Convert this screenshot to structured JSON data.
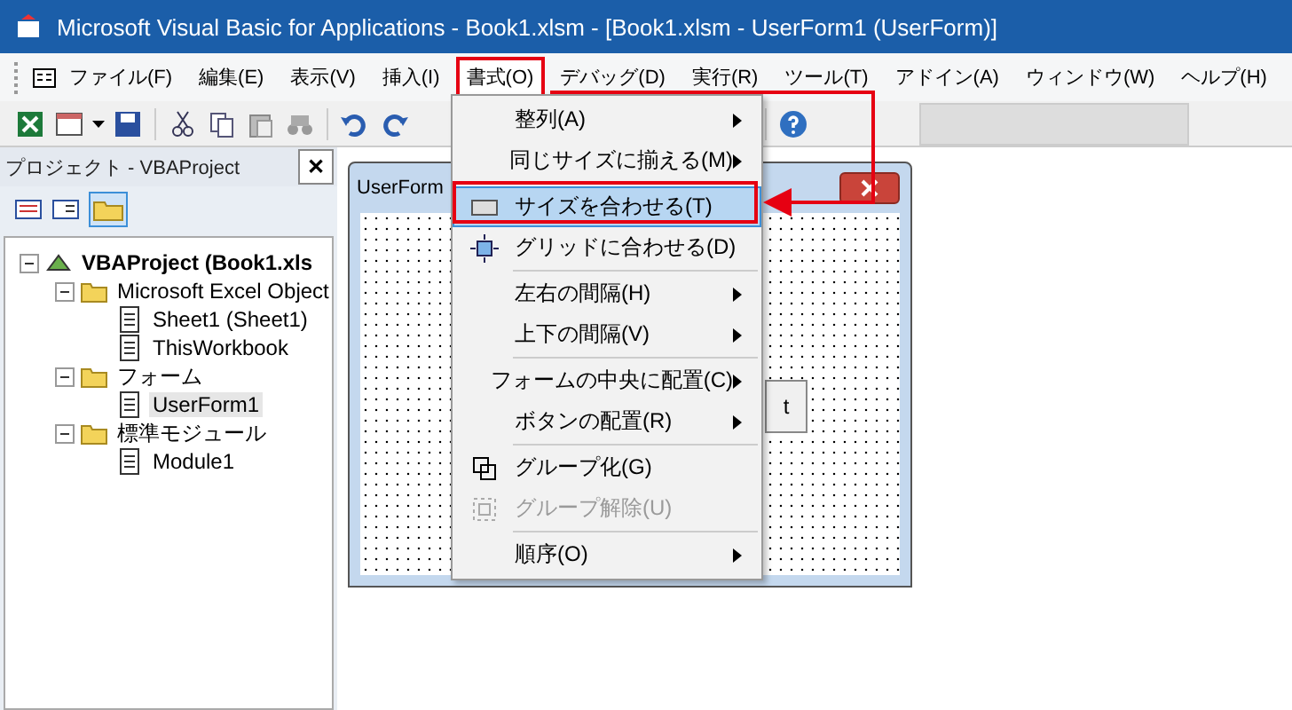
{
  "window": {
    "title": "Microsoft Visual Basic for Applications - Book1.xlsm - [Book1.xlsm - UserForm1 (UserForm)]"
  },
  "menu_bar": [
    {
      "label": "ファイル(F)",
      "selected": false
    },
    {
      "label": "編集(E)",
      "selected": false
    },
    {
      "label": "表示(V)",
      "selected": false
    },
    {
      "label": "挿入(I)",
      "selected": false
    },
    {
      "label": "書式(O)",
      "selected": true
    },
    {
      "label": "デバッグ(D)",
      "selected": false
    },
    {
      "label": "実行(R)",
      "selected": false
    },
    {
      "label": "ツール(T)",
      "selected": false
    },
    {
      "label": "アドイン(A)",
      "selected": false
    },
    {
      "label": "ウィンドウ(W)",
      "selected": false
    },
    {
      "label": "ヘルプ(H)",
      "selected": false
    }
  ],
  "project_panel": {
    "title": "プロジェクト - VBAProject",
    "close": "✕",
    "tree": [
      {
        "label": "VBAProject (Book1.xls",
        "expanded": true,
        "selected": false,
        "children": [
          {
            "label": "Microsoft Excel Object",
            "expanded": true,
            "selected": false,
            "children": [
              {
                "label": "Sheet1 (Sheet1)",
                "selected": false
              },
              {
                "label": "ThisWorkbook",
                "selected": false
              }
            ]
          },
          {
            "label": "フォーム",
            "expanded": true,
            "selected": false,
            "children": [
              {
                "label": "UserForm1",
                "selected": true
              }
            ]
          },
          {
            "label": "標準モジュール",
            "expanded": true,
            "selected": false,
            "children": [
              {
                "label": "Module1",
                "selected": false
              }
            ]
          }
        ]
      }
    ]
  },
  "form_window": {
    "title": "UserForm",
    "button_label": "t"
  },
  "format_menu": [
    {
      "kind": "submenu",
      "label": "整列(A)",
      "selected": false,
      "disabled": false
    },
    {
      "kind": "submenu",
      "label": "同じサイズに揃える(M)",
      "selected": false,
      "disabled": false
    },
    {
      "kind": "separator"
    },
    {
      "kind": "command",
      "label": "サイズを合わせる(T)",
      "selected": true,
      "disabled": false
    },
    {
      "kind": "command",
      "label": "グリッドに合わせる(D)",
      "selected": false,
      "disabled": false
    },
    {
      "kind": "separator"
    },
    {
      "kind": "submenu",
      "label": "左右の間隔(H)",
      "selected": false,
      "disabled": false
    },
    {
      "kind": "submenu",
      "label": "上下の間隔(V)",
      "selected": false,
      "disabled": false
    },
    {
      "kind": "separator"
    },
    {
      "kind": "submenu",
      "label": "フォームの中央に配置(C)",
      "selected": false,
      "disabled": false
    },
    {
      "kind": "submenu",
      "label": "ボタンの配置(R)",
      "selected": false,
      "disabled": false
    },
    {
      "kind": "separator"
    },
    {
      "kind": "command",
      "label": "グループ化(G)",
      "selected": false,
      "disabled": false
    },
    {
      "kind": "command",
      "label": "グループ解除(U)",
      "selected": false,
      "disabled": true
    },
    {
      "kind": "separator"
    },
    {
      "kind": "submenu",
      "label": "順序(O)",
      "selected": false,
      "disabled": false
    }
  ]
}
